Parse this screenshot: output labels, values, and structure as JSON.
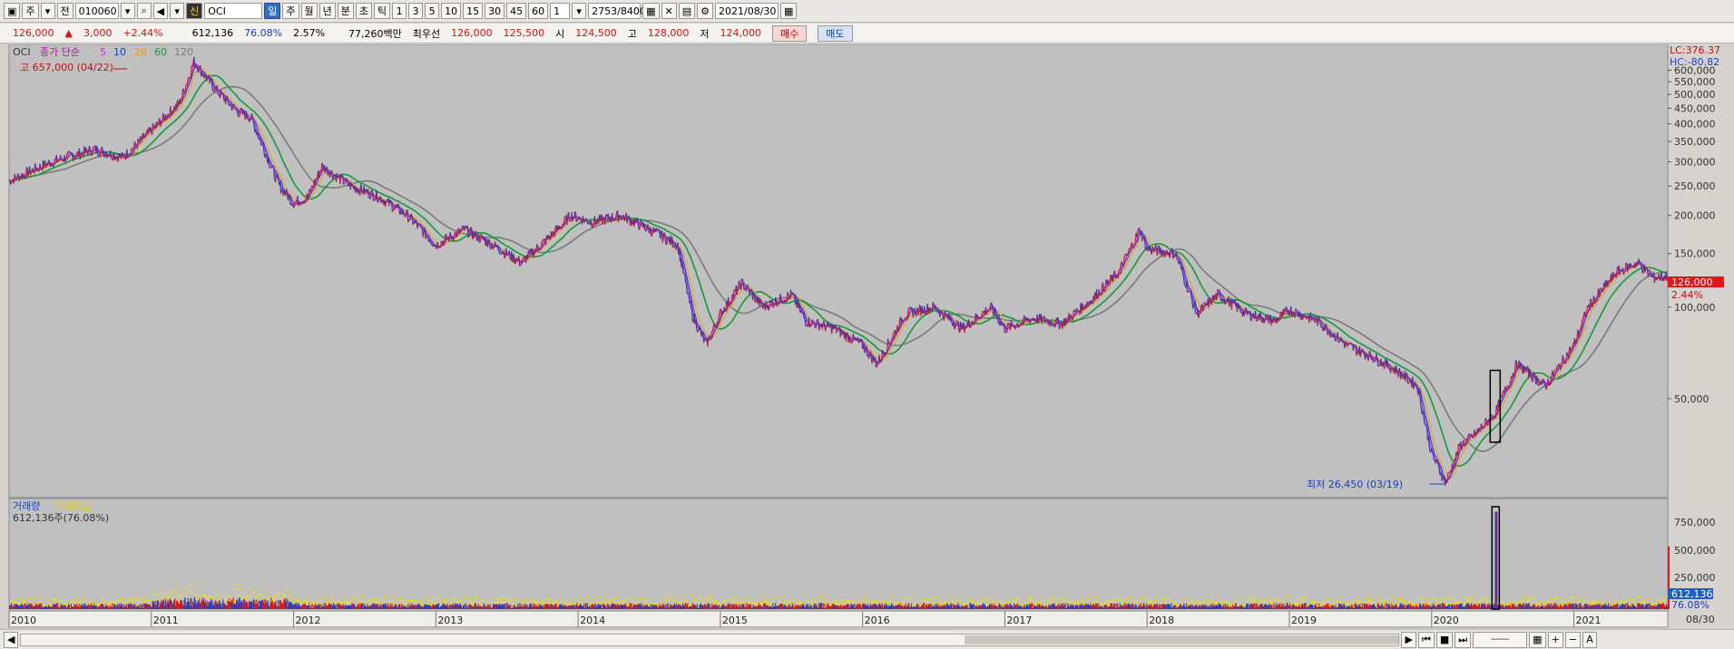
{
  "toolbar": {
    "period_selector": "주",
    "all_label": "전",
    "code": "010060",
    "new_badge": "신",
    "name": "OCI",
    "periods": [
      "일",
      "주",
      "월",
      "년",
      "분",
      "초",
      "틱"
    ],
    "intervals": [
      "1",
      "3",
      "5",
      "10",
      "15",
      "30",
      "45",
      "60"
    ],
    "count_value": "1",
    "data_count": "2753",
    "data_total": "/8400",
    "date": "2021/08/30"
  },
  "quote": {
    "price": "126,000",
    "change_arrow": "▲",
    "change": "3,000",
    "change_pct": "+2.44%",
    "volume": "612,136",
    "volume_ratio": "76.08%",
    "turnover": "2.57%",
    "amount": "77,260백만",
    "best_label": "최우선",
    "best_ask": "126,000",
    "best_bid": "125,500",
    "open_label": "시",
    "open": "124,500",
    "high_label": "고",
    "high": "128,000",
    "low_label": "저",
    "low": "124,000",
    "buy_label": "매수",
    "sell_label": "매도"
  },
  "legend": {
    "name": "OCI",
    "price_label": "종가 단순",
    "ma": [
      "5",
      "10",
      "20",
      "60",
      "120"
    ],
    "ma_colors": [
      "#d11fd1",
      "#1740c9",
      "#e8a000",
      "#159a3a",
      "#7a7a7a"
    ],
    "high_label": "고 657,000 (04/22)",
    "low_label": "최저 26,450 (03/19)",
    "lc_label": "LC:376.37",
    "hc_label": "HC:-80.82",
    "current_price": "126,000",
    "current_pct": "2.44%"
  },
  "volume_panel": {
    "label1": "거래량",
    "label2": "거래대금",
    "sub_label": "612,136주(76.08%)",
    "current_volume": "612,136",
    "current_pct": "76.08%",
    "y_ticks": [
      "750,000",
      "500,000",
      "250,000"
    ]
  },
  "footer": {
    "last_date": "08/30"
  },
  "chart_data": {
    "type": "line",
    "title": "OCI",
    "y_scale": "log",
    "ylim": [
      24000,
      700000
    ],
    "y_ticks": [
      600000,
      550000,
      500000,
      450000,
      400000,
      350000,
      300000,
      250000,
      200000,
      150000,
      100000,
      50000
    ],
    "x_ticks": [
      "2010",
      "2011",
      "2012",
      "2013",
      "2014",
      "2015",
      "2016",
      "2017",
      "2018",
      "2019",
      "2020",
      "2021"
    ],
    "price_series": {
      "name": "종가",
      "x": [
        2010.0,
        2010.3,
        2010.6,
        2010.8,
        2011.0,
        2011.2,
        2011.3,
        2011.45,
        2011.6,
        2011.7,
        2011.9,
        2012.0,
        2012.1,
        2012.2,
        2012.4,
        2012.6,
        2012.8,
        2013.0,
        2013.2,
        2013.4,
        2013.6,
        2013.8,
        2013.95,
        2014.1,
        2014.3,
        2014.5,
        2014.7,
        2014.8,
        2014.9,
        2015.0,
        2015.15,
        2015.3,
        2015.5,
        2015.6,
        2015.8,
        2016.0,
        2016.1,
        2016.3,
        2016.5,
        2016.7,
        2016.9,
        2017.0,
        2017.2,
        2017.4,
        2017.6,
        2017.8,
        2017.95,
        2018.0,
        2018.2,
        2018.35,
        2018.5,
        2018.7,
        2018.9,
        2019.0,
        2019.2,
        2019.4,
        2019.6,
        2019.75,
        2019.9,
        2020.0,
        2020.1,
        2020.2,
        2020.3,
        2020.45,
        2020.6,
        2020.8,
        2021.0,
        2021.1,
        2021.3,
        2021.45,
        2021.55,
        2021.66
      ],
      "y": [
        260000,
        300000,
        330000,
        310000,
        380000,
        470000,
        640000,
        520000,
        440000,
        420000,
        250000,
        220000,
        230000,
        290000,
        250000,
        230000,
        200000,
        160000,
        180000,
        160000,
        140000,
        170000,
        200000,
        190000,
        200000,
        180000,
        160000,
        95000,
        75000,
        95000,
        120000,
        100000,
        110000,
        90000,
        85000,
        75000,
        65000,
        95000,
        100000,
        85000,
        100000,
        85000,
        92000,
        88000,
        105000,
        130000,
        180000,
        155000,
        150000,
        95000,
        110000,
        95000,
        90000,
        98000,
        90000,
        75000,
        68000,
        62000,
        55000,
        33000,
        26450,
        35000,
        38000,
        45000,
        65000,
        55000,
        75000,
        100000,
        130000,
        140000,
        125000,
        126000
      ]
    },
    "ma_series": [
      {
        "name": "5",
        "values_note_free": true
      },
      {
        "name": "10"
      },
      {
        "name": "20"
      },
      {
        "name": "60"
      },
      {
        "name": "120"
      }
    ],
    "volume": {
      "name": "거래량",
      "ylim": [
        0,
        1000000
      ],
      "highlight_date": "2020",
      "peak": 950000,
      "current": 612136
    }
  }
}
